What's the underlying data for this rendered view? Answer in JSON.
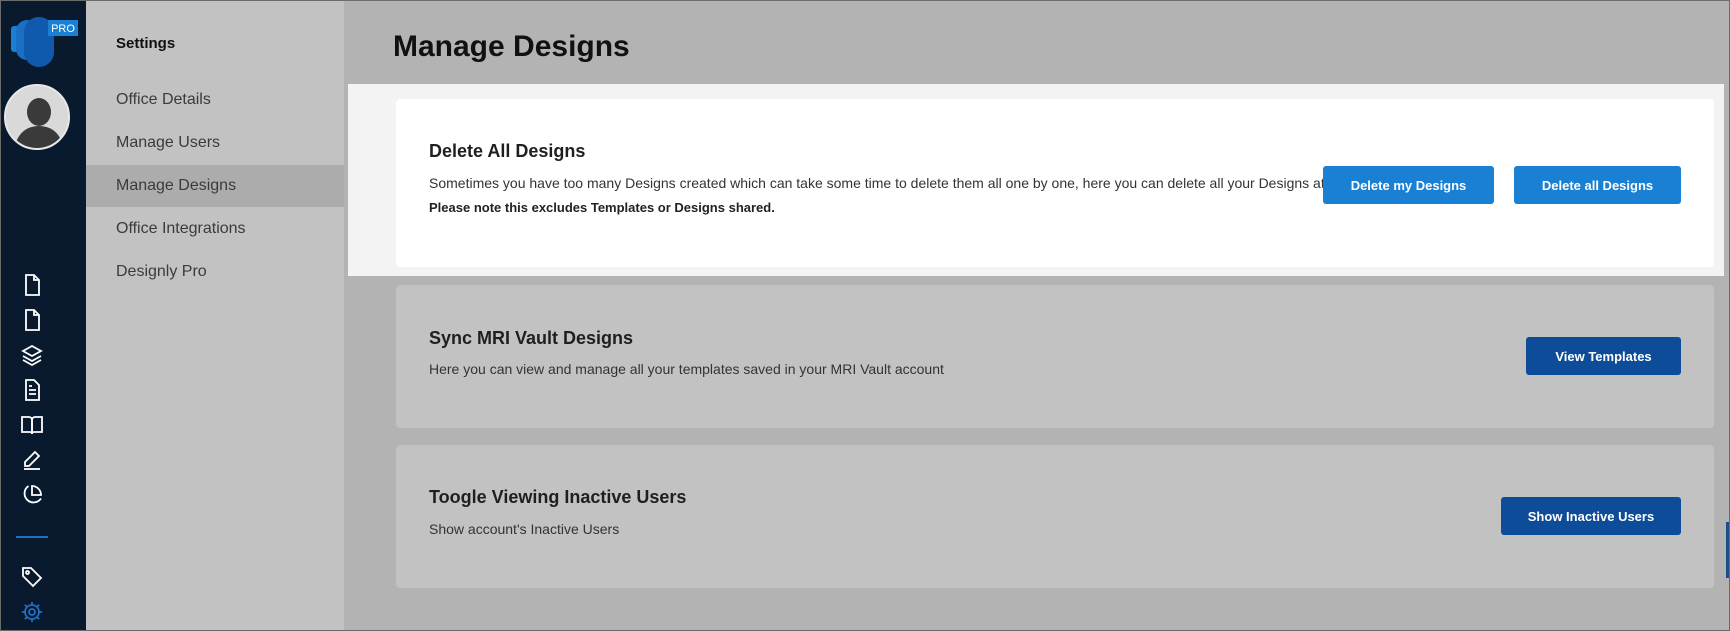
{
  "brand": {
    "badge": "PRO"
  },
  "rail": {
    "icons": [
      "file-icon",
      "file-icon",
      "layers-icon",
      "document-icon",
      "book-icon",
      "edit-icon",
      "pie-chart-icon",
      "tag-icon",
      "gear-icon"
    ],
    "accent": "#1f6fc2"
  },
  "sidebar": {
    "title": "Settings",
    "items": [
      {
        "label": "Office Details"
      },
      {
        "label": "Manage Users"
      },
      {
        "label": "Manage Designs",
        "active": true
      },
      {
        "label": "Office Integrations"
      },
      {
        "label": "Designly Pro"
      }
    ]
  },
  "main": {
    "title": "Manage Designs",
    "cards": [
      {
        "title": "Delete All Designs",
        "description": "Sometimes you have too many Designs created which can take some time to delete them all one by one, here you can delete all your Designs at once.",
        "note": "Please note this excludes Templates or Designs shared.",
        "buttons": [
          "Delete my Designs",
          "Delete all Designs"
        ]
      },
      {
        "title": "Sync MRI Vault Designs",
        "description": "Here you can view and manage all your templates saved in your MRI Vault account",
        "buttons": [
          "View Templates"
        ]
      },
      {
        "title": "Toogle Viewing Inactive Users",
        "description": "Show account's Inactive Users",
        "buttons": [
          "Show Inactive Users"
        ]
      }
    ]
  },
  "colors": {
    "rail_bg": "#0a1a2e",
    "button_primary": "#1a80d4",
    "button_dark": "#0d4c99"
  }
}
